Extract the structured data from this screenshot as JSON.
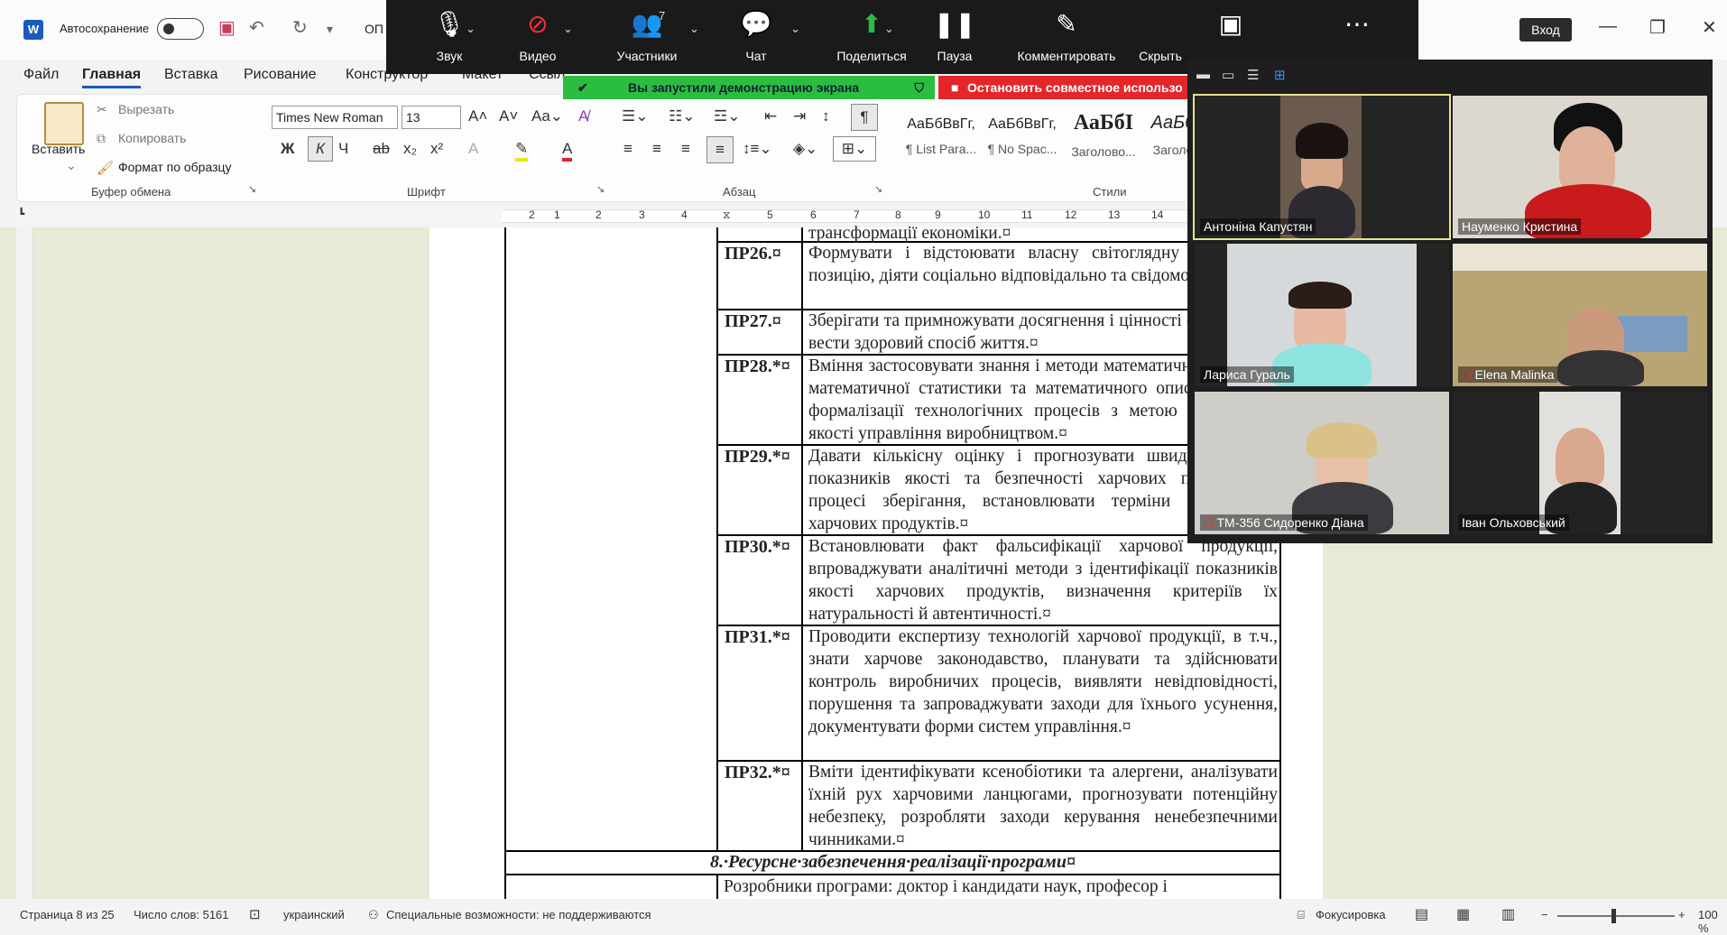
{
  "word": {
    "title_bar": {
      "autosave_label": "Автосохранение",
      "doc_name": "ОП",
      "login_label": "Вход"
    },
    "tabs": [
      "Файл",
      "Главная",
      "Вставка",
      "Рисование",
      "Конструктор",
      "Макет",
      "Ссыл"
    ],
    "active_tab": "Главная",
    "ribbon": {
      "paste_label": "Вставить",
      "cut_label": "Вырезать",
      "copy_label": "Копировать",
      "format_painter_label": "Формат по образцу",
      "clipboard_group": "Буфер обмена",
      "font_name": "Times New Roman",
      "font_size": "13",
      "font_group": "Шрифт",
      "paragraph_group": "Абзац",
      "styles_group": "Стили",
      "bold": "Ж",
      "italic": "К",
      "underline": "Ч",
      "styles": [
        {
          "sample": "АаБбВвГг,",
          "name": "¶ List Para..."
        },
        {
          "sample": "АаБбВвГг,",
          "name": "¶ No Spac..."
        },
        {
          "sample": "АаБбI",
          "name": "Заголово..."
        },
        {
          "sample": "АаБб",
          "name": "Заголо"
        }
      ]
    },
    "ruler_numbers": [
      "2",
      "1",
      "1",
      "2",
      "3",
      "4",
      "5",
      "6",
      "7",
      "8",
      "9",
      "10",
      "11",
      "12",
      "13",
      "14",
      "15"
    ],
    "document": {
      "top_fragment": "трансформації економіки.¤",
      "rows": [
        {
          "code": "ПР26.¤",
          "text": "Формувати і відстоювати власну світоглядну громадську позицію, діяти соціально відповідально та свідомо.¤"
        },
        {
          "code": "ПР27.¤",
          "text": "Зберігати та примножувати досягнення і цінності суспільства, вести здоровий спосіб життя.¤"
        },
        {
          "code": "ПР28.*¤",
          "text": "Вміння застосовувати знання і методи математичного аналізу, математичної статистики та математичного описування для формалізації технологічних процесів з метою підвищення якості управління виробництвом.¤"
        },
        {
          "code": "ПР29.*¤",
          "text": "Давати кількісну оцінку і прогнозувати швидкість зміни показників якості та безпечності харчових продуктів у процесі зберігання, встановлювати терміни придатності харчових продуктів.¤"
        },
        {
          "code": "ПР30.*¤",
          "text": "Встановлювати факт фальсифікації харчової продукції, впроваджувати аналітичні методи з ідентифікації показників якості харчових продуктів, визначення критеріїв їх натуральності й автентичності.¤"
        },
        {
          "code": "ПР31.*¤",
          "text": "Проводити експертизу технологій харчової продукції, в т.ч., знати харчове законодавство, планувати та здійснювати контроль виробничих процесів, виявляти невідповідності, порушення та запроваджувати заходи для їхнього усунення, документувати форми систем управління.¤"
        },
        {
          "code": "ПР32.*¤",
          "text": "Вміти ідентифікувати ксенобіотики та алергени, аналізувати їхній рух харчовими ланцюгами, прогнозувати потенційну небезпеку, розробляти заходи керування ненебезпечними чинниками.¤"
        }
      ],
      "section_title": "8.·Ресурсне·забезпечення·реалізації·програми¤",
      "bottom_fragment": "Розробники програми: доктор і кандидати наук, професор і"
    },
    "status_bar": {
      "page": "Страница 8 из 25",
      "words": "Число слов: 5161",
      "language": "украинский",
      "accessibility": "Специальные возможности: не поддерживаются",
      "focus": "Фокусировка",
      "zoom": "100 %"
    }
  },
  "zoom": {
    "toolbar": [
      {
        "id": "audio",
        "label": "Звук"
      },
      {
        "id": "video",
        "label": "Видео"
      },
      {
        "id": "participants",
        "label": "Участники",
        "count": "7"
      },
      {
        "id": "chat",
        "label": "Чат"
      },
      {
        "id": "share",
        "label": "Поделиться"
      },
      {
        "id": "pause",
        "label": "Пауза"
      },
      {
        "id": "annotate",
        "label": "Комментировать"
      },
      {
        "id": "hide",
        "label": "Скрыть"
      }
    ],
    "share_banner": "Вы запустили демонстрацию экрана",
    "stop_banner": "Остановить совместное использо",
    "participants": [
      {
        "name": "Антоніна Капустян",
        "muted": false,
        "speaking": true
      },
      {
        "name": "Науменко Кристина",
        "muted": false,
        "speaking": false
      },
      {
        "name": "Лариса Гураль",
        "muted": false,
        "speaking": false
      },
      {
        "name": "Elena Malinka",
        "muted": true,
        "speaking": false
      },
      {
        "name": "ТМ-356 Сидоренко Діана",
        "muted": true,
        "speaking": false
      },
      {
        "name": "Іван Ольховський",
        "muted": false,
        "speaking": false
      }
    ]
  }
}
